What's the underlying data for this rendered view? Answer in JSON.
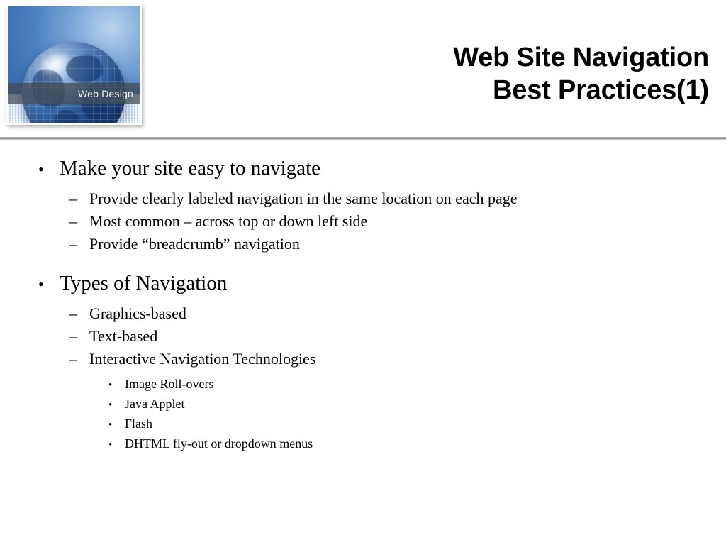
{
  "slide": {
    "title_lines": [
      "Web Site Navigation",
      "Best Practices(1)"
    ],
    "header_image": {
      "caption": "Web Design",
      "alt": "blue glass globe"
    },
    "divider_color": "#8d8d8d",
    "background_color": "#ffffff",
    "text_color": "#000000",
    "content": [
      {
        "level": 1,
        "marker": "•",
        "text": "Make your site easy to navigate"
      },
      {
        "level": 2,
        "marker": "–",
        "text": "Provide clearly labeled navigation in the same location on each page"
      },
      {
        "level": 2,
        "marker": "–",
        "text": "Most common – across top or down left side"
      },
      {
        "level": 2,
        "marker": "–",
        "text": "Provide “breadcrumb” navigation"
      },
      {
        "level": 1,
        "marker": "•",
        "text": "Types of Navigation"
      },
      {
        "level": 2,
        "marker": "–",
        "text": "Graphics-based"
      },
      {
        "level": 2,
        "marker": "–",
        "text": "Text-based"
      },
      {
        "level": 2,
        "marker": "–",
        "text": "Interactive Navigation Technologies"
      },
      {
        "level": 3,
        "marker": "•",
        "text": "Image Roll-overs"
      },
      {
        "level": 3,
        "marker": "•",
        "text": "Java Applet"
      },
      {
        "level": 3,
        "marker": "•",
        "text": "Flash"
      },
      {
        "level": 3,
        "marker": "•",
        "text": "DHTML fly-out or dropdown menus"
      }
    ]
  }
}
